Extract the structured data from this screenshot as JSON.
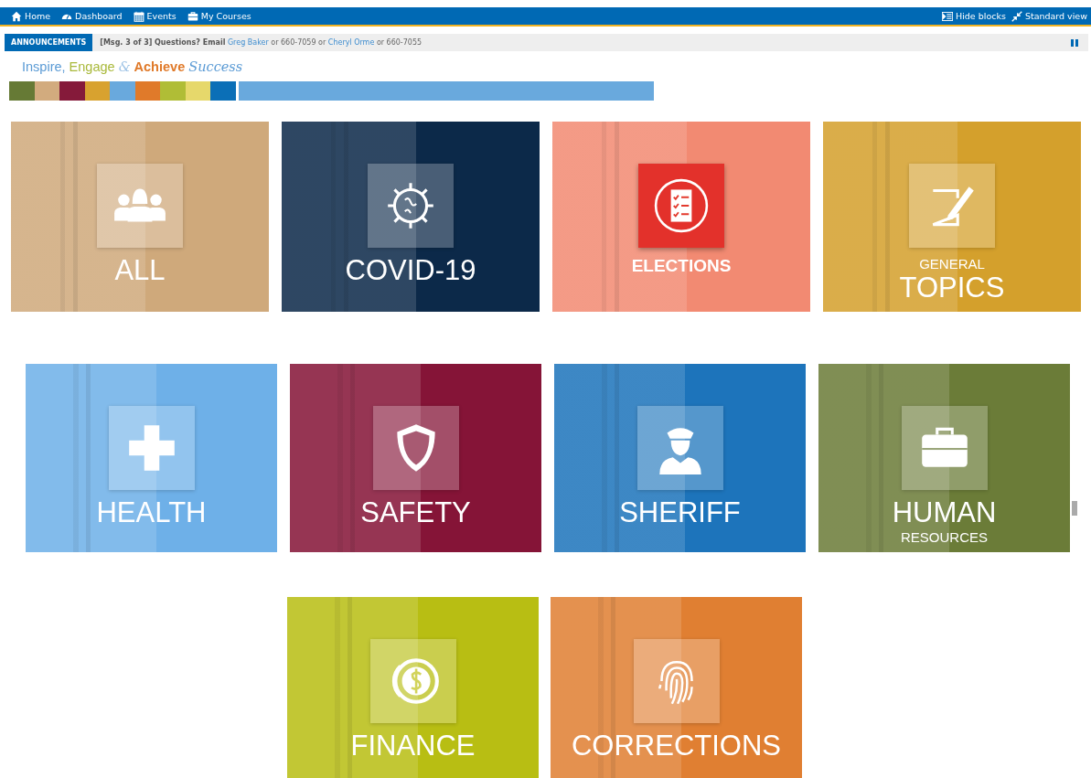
{
  "nav": {
    "items": [
      {
        "label": "Home",
        "kind": "home"
      },
      {
        "label": "Dashboard",
        "kind": "gauge"
      },
      {
        "label": "Events",
        "kind": "calendar"
      },
      {
        "label": "My Courses",
        "kind": "briefcase"
      }
    ],
    "actions": [
      {
        "label": "Hide blocks",
        "kind": "blocks"
      },
      {
        "label": "Standard view",
        "kind": "compress"
      }
    ]
  },
  "announcement": {
    "label": "ANNOUNCEMENTS",
    "counter": "[Msg. 3 of 3]",
    "lead": "Questions? Email",
    "parts": [
      {
        "kind": "link",
        "text": "Greg Baker"
      },
      {
        "kind": "text",
        "text": "or 660-7059 or"
      },
      {
        "kind": "link",
        "text": "Cheryl Orme"
      },
      {
        "kind": "text",
        "text": "or 660-7055"
      }
    ]
  },
  "tagline": [
    {
      "text": "Inspire,",
      "color": "#5b9bd5",
      "kind": "plain"
    },
    {
      "text": "Engage",
      "color": "#a9b93b",
      "kind": "plain"
    },
    {
      "text": "&",
      "color": "#9ec3e6",
      "kind": "script"
    },
    {
      "text": "Achieve",
      "color": "#e07a2a",
      "kind": "bold"
    },
    {
      "text": "Success",
      "color": "#5b9bd5",
      "kind": "script"
    }
  ],
  "color_strip": [
    {
      "color": "#667a35",
      "kind": "swatch"
    },
    {
      "color": "#d2ab7e",
      "kind": "swatch"
    },
    {
      "color": "#851a3a",
      "kind": "swatch"
    },
    {
      "color": "#d8a22f",
      "kind": "swatch"
    },
    {
      "color": "#69a9dd",
      "kind": "swatch"
    },
    {
      "color": "#e07a2a",
      "kind": "swatch"
    },
    {
      "color": "#b0bd36",
      "kind": "swatch"
    },
    {
      "color": "#e6d86b",
      "kind": "swatch"
    },
    {
      "color": "#0b6fb7",
      "kind": "swatch"
    },
    {
      "color": "#69a9dd",
      "kind": "wide"
    }
  ],
  "tile_rows": [
    [
      {
        "kind": "people",
        "color": "#cfa97b",
        "highlighted": false,
        "lines": [
          {
            "text": "ALL",
            "kind": "major"
          }
        ]
      },
      {
        "kind": "virus",
        "color": "#0c2949",
        "highlighted": false,
        "lines": [
          {
            "text": "COVID-19",
            "kind": "major"
          }
        ]
      },
      {
        "kind": "checklist",
        "color": "#f28a72",
        "highlighted": true,
        "lines": [
          {
            "text": "ELECTIONS",
            "kind": "medium"
          }
        ]
      },
      {
        "kind": "pen",
        "color": "#d4a02c",
        "highlighted": false,
        "lines": [
          {
            "text": "GENERAL",
            "kind": "minor"
          },
          {
            "text": "TOPICS",
            "kind": "major"
          }
        ]
      }
    ],
    [
      {
        "kind": "plus",
        "color": "#6eb0e8",
        "highlighted": false,
        "lines": [
          {
            "text": "HEALTH",
            "kind": "major"
          }
        ]
      },
      {
        "kind": "shield",
        "color": "#851437",
        "highlighted": false,
        "lines": [
          {
            "text": "SAFETY",
            "kind": "major"
          }
        ]
      },
      {
        "kind": "officer",
        "color": "#1d74bb",
        "highlighted": false,
        "lines": [
          {
            "text": "SHERIFF",
            "kind": "major"
          }
        ]
      },
      {
        "kind": "briefcase",
        "color": "#6b7c38",
        "highlighted": false,
        "lines": [
          {
            "text": "HUMAN",
            "kind": "major"
          },
          {
            "text": "RESOURCES",
            "kind": "minor"
          }
        ]
      }
    ],
    [
      {
        "kind": "coin",
        "color": "#b8be13",
        "highlighted": false,
        "lines": [
          {
            "text": "FINANCE",
            "kind": "major"
          }
        ]
      },
      {
        "kind": "fingerprint",
        "color": "#e07f32",
        "highlighted": false,
        "lines": [
          {
            "text": "CORRECTIONS",
            "kind": "major"
          }
        ]
      }
    ]
  ]
}
